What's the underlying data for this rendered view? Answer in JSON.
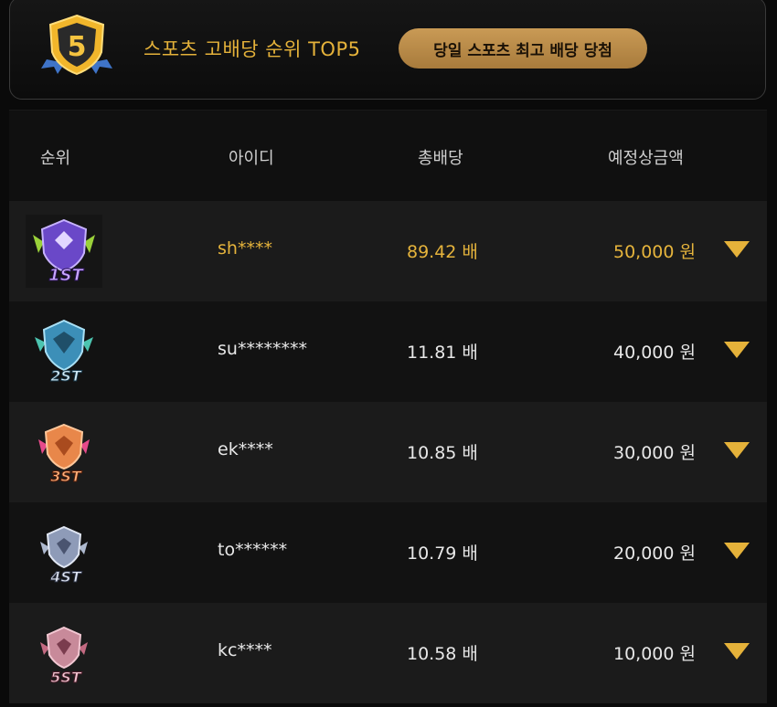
{
  "header": {
    "badge_number": "5",
    "title": "스포츠 고배당 순위 TOP5",
    "pill_label": "당일 스포츠 최고 배당 당첨"
  },
  "table": {
    "columns": [
      "순위",
      "아이디",
      "총배당",
      "예정상금액"
    ],
    "rows": [
      {
        "rank_label": "1ST",
        "rank_icon": "rank-1-emblem-icon",
        "id": "sh****",
        "odds": "89.42 배",
        "prize": "50,000 원"
      },
      {
        "rank_label": "2ST",
        "rank_icon": "rank-2-emblem-icon",
        "id": "su********",
        "odds": "11.81 배",
        "prize": "40,000 원"
      },
      {
        "rank_label": "3ST",
        "rank_icon": "rank-3-emblem-icon",
        "id": "ek****",
        "odds": "10.85 배",
        "prize": "30,000 원"
      },
      {
        "rank_label": "4ST",
        "rank_icon": "rank-4-emblem-icon",
        "id": "to******",
        "odds": "10.79 배",
        "prize": "20,000 원"
      },
      {
        "rank_label": "5ST",
        "rank_icon": "rank-5-emblem-icon",
        "id": "kc****",
        "odds": "10.58 배",
        "prize": "10,000 원"
      }
    ]
  },
  "colors": {
    "gold": "#e6b43c",
    "pill": "#b8874a",
    "rank1": "#7a5bd6",
    "rank2": "#4fa6c9",
    "rank3": "#e8874a",
    "rank4": "#8e9bb8",
    "rank5": "#c88a9a"
  }
}
